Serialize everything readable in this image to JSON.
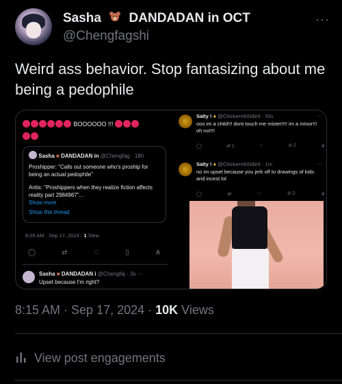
{
  "author": {
    "name": "Sasha",
    "name_suffix": "DANDADAN in OCT",
    "handle": "@Chengfagshi",
    "more": "···"
  },
  "tweet": {
    "text": "Weird ass behavior. Stop fantasizing about me being a pedophile"
  },
  "left_shot": {
    "boo_text": "BOOOOOO !!!",
    "quote": {
      "name": "Sasha",
      "name_suffix": "DANDADAN in",
      "handle_time": "@Chengfag · 18h",
      "line1": "Proshipper: \"Calls out someone who's proship for being an actual pedophile\"",
      "line2": "Antis: \"Proshippers when they realize fiction affects reality part 2984967\"...",
      "show_more": "Show more",
      "show_thread": "Show this thread"
    },
    "meta_time": "8:09 AM · Sep 17, 2024 · ",
    "meta_views_count": "1",
    "meta_views_label": " View",
    "reply": {
      "name": "Sasha",
      "name_suffix": "DANDADAN i",
      "handle_time": "@Chengfaj · 3s",
      "dots": "···",
      "text": "Upset because I'm right?"
    }
  },
  "right_shot": {
    "post1": {
      "name": "Salty !",
      "handle_time": "@ChickenN00dle5 · 55s",
      "text": "ooo im a child!!! dont touch me mister!!!! im a minor!!! oh no!!!!",
      "retweets": "1",
      "views": "2",
      "dots": "···"
    },
    "post2": {
      "name": "Salty !",
      "handle_time": "@ChickenN00dle5 · 1m",
      "text": "no im upset because you jerk off to drawings of kids and incest lol",
      "views": "2",
      "dots": "···"
    }
  },
  "footer": {
    "time": "8:15 AM · Sep 17, 2024 · ",
    "views_count": "10K",
    "views_label": " Views",
    "engagements": "View post engagements"
  },
  "colors": {
    "accent": "#1d9bf0",
    "muted": "#71767b",
    "border": "#2f3336"
  }
}
